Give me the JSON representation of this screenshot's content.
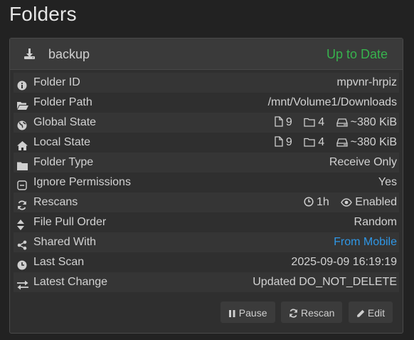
{
  "page": {
    "title": "Folders"
  },
  "folder": {
    "name": "backup",
    "status": "Up to Date",
    "status_color": "#37b24d",
    "header_icon": "download-icon"
  },
  "rows": {
    "folder_id": {
      "label": "Folder ID",
      "value": "mpvnr-hrpiz",
      "icon": "info-icon"
    },
    "folder_path": {
      "label": "Folder Path",
      "value": "/mnt/Volume1/Downloads",
      "icon": "folder-open-icon"
    },
    "global_state": {
      "label": "Global State",
      "files": "9",
      "dirs": "4",
      "size": "~380 KiB",
      "icon": "globe-icon"
    },
    "local_state": {
      "label": "Local State",
      "files": "9",
      "dirs": "4",
      "size": "~380 KiB",
      "icon": "home-icon"
    },
    "folder_type": {
      "label": "Folder Type",
      "value": "Receive Only",
      "icon": "folder-icon"
    },
    "ignore_permissions": {
      "label": "Ignore Permissions",
      "value": "Yes",
      "icon": "minus-square-icon"
    },
    "rescans": {
      "label": "Rescans",
      "interval": "1h",
      "watcher": "Enabled",
      "icon": "refresh-icon"
    },
    "file_pull_order": {
      "label": "File Pull Order",
      "value": "Random",
      "icon": "sort-icon"
    },
    "shared_with": {
      "label": "Shared With",
      "value": "From Mobile",
      "icon": "share-icon",
      "link_color": "#2f97e6"
    },
    "last_scan": {
      "label": "Last Scan",
      "value": "2025-09-09 16:19:19",
      "icon": "clock-icon"
    },
    "latest_change": {
      "label": "Latest Change",
      "value": "Updated DO_NOT_DELETE",
      "icon": "exchange-icon"
    }
  },
  "actions": {
    "pause": "Pause",
    "rescan": "Rescan",
    "edit": "Edit"
  }
}
